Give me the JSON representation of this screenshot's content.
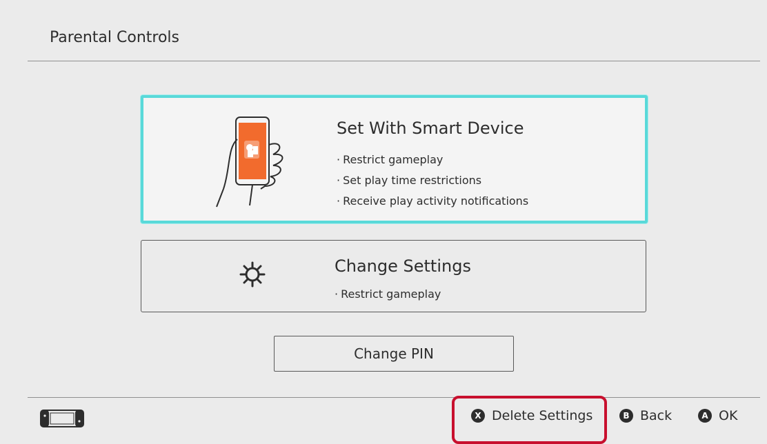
{
  "header": {
    "title": "Parental Controls"
  },
  "options": {
    "smart_device": {
      "title": "Set With Smart Device",
      "bullets": [
        "Restrict gameplay",
        "Set play time restrictions",
        "Receive play activity notifications"
      ]
    },
    "change_settings": {
      "title": "Change Settings",
      "bullets": [
        "Restrict gameplay"
      ]
    }
  },
  "change_pin_label": "Change PIN",
  "footer": {
    "delete": {
      "glyph": "X",
      "label": "Delete Settings"
    },
    "back": {
      "glyph": "B",
      "label": "Back"
    },
    "ok": {
      "glyph": "A",
      "label": "OK"
    }
  },
  "colors": {
    "selected_border": "#59d9d9",
    "app_orange": "#f26b2d",
    "highlight_red": "#c8102e"
  },
  "icons": [
    "phone-in-hand-icon",
    "gear-icon",
    "console-icon"
  ]
}
